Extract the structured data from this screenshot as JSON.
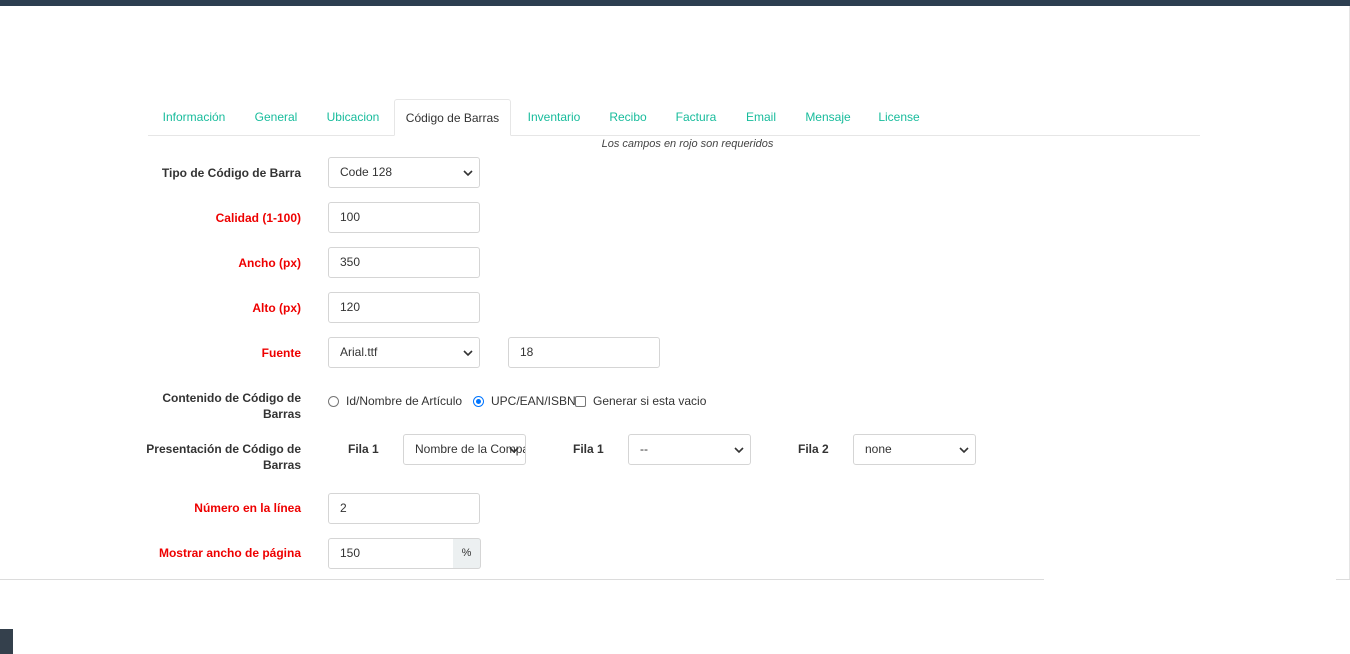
{
  "tabs": [
    {
      "label": "Información"
    },
    {
      "label": "General"
    },
    {
      "label": "Ubicacion"
    },
    {
      "label": "Código de Barras"
    },
    {
      "label": "Inventario"
    },
    {
      "label": "Recibo"
    },
    {
      "label": "Factura"
    },
    {
      "label": "Email"
    },
    {
      "label": "Mensaje"
    },
    {
      "label": "License"
    }
  ],
  "active_tab": "Código de Barras",
  "required_note": "Los campos en rojo son requeridos",
  "form": {
    "barcode_type": {
      "label": "Tipo de Código de Barra",
      "value": "Code 128"
    },
    "quality": {
      "label": "Calidad (1-100)",
      "value": "100"
    },
    "width": {
      "label": "Ancho (px)",
      "value": "350"
    },
    "height": {
      "label": "Alto (px)",
      "value": "120"
    },
    "font": {
      "label": "Fuente",
      "value": "Arial.ttf",
      "size": "18"
    },
    "content": {
      "label_line1": "Contenido de Código de",
      "label_line2": "Barras",
      "option_id": "Id/Nombre de Artículo",
      "option_upc": "UPC/EAN/ISBN",
      "selected": "UPC/EAN/ISBN",
      "generate_label": "Generar si esta vacio",
      "generate_checked": false
    },
    "presentation": {
      "label_line1": "Presentación de Código de",
      "label_line2": "Barras",
      "row1_label": "Fila 1",
      "row1_value": "Nombre de la Compañía",
      "row1b_label": "Fila 1",
      "row1b_value": "--",
      "row2_label": "Fila 2",
      "row2_value": "none"
    },
    "number_per_line": {
      "label": "Número en la línea",
      "value": "2"
    },
    "page_width": {
      "label": "Mostrar ancho de página",
      "value": "150",
      "addon": "%"
    }
  },
  "colors": {
    "accent": "#18bc9c",
    "required": "#ee0000",
    "topbar": "#2c3e50"
  }
}
